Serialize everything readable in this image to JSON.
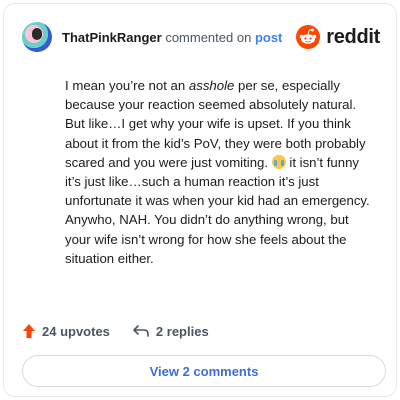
{
  "comment": {
    "username": "ThatPinkRanger",
    "action_text": "commented on",
    "link_text": "post",
    "brand_name": "reddit",
    "body": {
      "part1": "I mean you’re not an ",
      "emphasis": "asshole",
      "part2": " per se, especially because your reaction seemed absolutely natural. But like…I get why your wife is upset. If you think about it from the kid’s PoV, they were both probably scared and you were just vomiting. ",
      "part3": " it isn’t funny it’s just like…such a human reaction it’s just unfortunate it was when your kid had an emergency. Anywho, NAH. You didn’t do anything wrong, but your wife isn’t wrong for how she feels about the situation either."
    },
    "upvotes_label": "24 upvotes",
    "replies_label": "2 replies",
    "view_button_label": "View 2 comments"
  },
  "colors": {
    "brand_orange": "#ff4500",
    "link_blue": "#3b82f6",
    "upvote_orange": "#ff4500"
  },
  "icons": {
    "emoji": "crying-laughing-emoji",
    "upvote": "upvote-arrow-icon",
    "reply": "reply-arrow-icon"
  }
}
